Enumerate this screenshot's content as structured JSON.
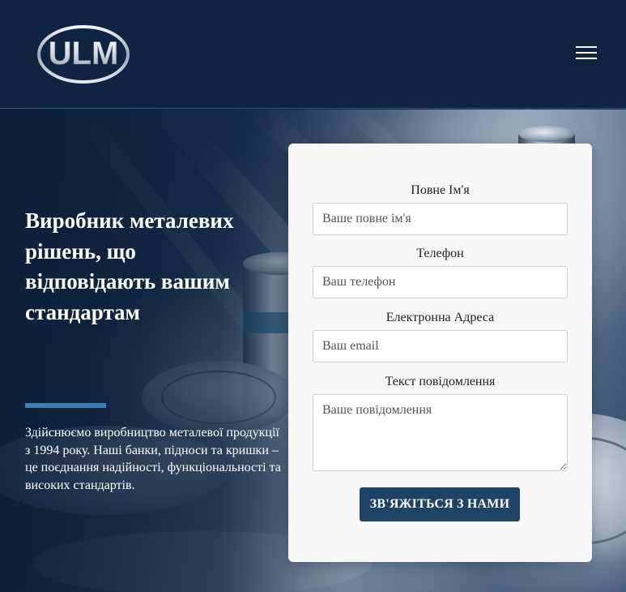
{
  "header": {
    "logo_text": "ULM",
    "menu_icon": "hamburger-menu-icon"
  },
  "hero": {
    "headline": "Виробник металевих рішень, що відповідають вашим стандартам",
    "intro": "Здійснюємо виробництво металевої продукції з 1994 року. Наші банки, підноси та кришки – це поєднання надійності, функціональності та високих стандартів."
  },
  "form": {
    "name_label": "Повне Ім'я",
    "name_placeholder": "Ваше повне ім'я",
    "phone_label": "Телефон",
    "phone_placeholder": "Ваш телефон",
    "email_label": "Електронна Адреса",
    "email_placeholder": "Ваш email",
    "message_label": "Текст повідомлення",
    "message_placeholder": "Ваше повідомлення",
    "submit_label": "ЗВ'ЯЖІТЬСЯ З НАМИ"
  },
  "colors": {
    "header_bg": "#0f2441",
    "accent": "#3d7eb5",
    "button_bg": "#1d4467",
    "card_bg": "#f7f7f7"
  }
}
